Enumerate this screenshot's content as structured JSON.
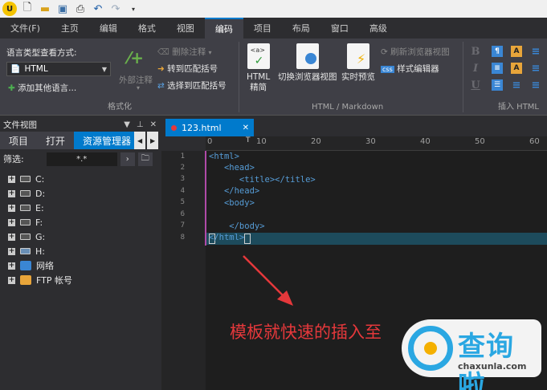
{
  "menu_tabs": [
    "文件(F)",
    "主页",
    "编辑",
    "格式",
    "视图",
    "编码",
    "项目",
    "布局",
    "窗口",
    "高级"
  ],
  "active_menu_tab": "编码",
  "ribbon": {
    "lang_view_label": "语言类型查看方式:",
    "lang_value": "HTML",
    "add_lang_label": "添加其他语言...",
    "outer_comment": "外部注释",
    "delete_comment": "删除注释",
    "goto_bracket": "转到匹配括号",
    "select_bracket": "选择到匹配括号",
    "format_group": "格式化",
    "html_tidy": [
      "HTML",
      "精简"
    ],
    "switch_browser_view": "切换浏览器视图",
    "live_preview": "实时预览",
    "refresh_browser_view": "刷新浏览器视图",
    "style_editor": "样式编辑器",
    "html_md_group": "HTML / Markdown",
    "insert_html_group": "插入 HTML"
  },
  "left_panel": {
    "title": "文件视图",
    "tabs": [
      "项目",
      "打开",
      "资源管理器"
    ],
    "active_tab": "资源管理器",
    "filter_label": "筛选:",
    "filter_value": "*.*",
    "drives": [
      "C:",
      "D:",
      "E:",
      "F:",
      "G:",
      "H:"
    ],
    "network": "网络",
    "ftp": "FTP 帐号"
  },
  "editor": {
    "tab_name": "123.html",
    "ruler_numbers": [
      "0",
      "10",
      "20",
      "30",
      "40",
      "50",
      "60"
    ],
    "line_numbers": [
      "1",
      "2",
      "3",
      "4",
      "5",
      "6",
      "7",
      "8"
    ],
    "code_lines": [
      "<html>",
      "   <head>",
      "      <title></title>",
      "   </head>",
      "   <body>",
      "",
      "    </body>",
      "</html>"
    ]
  },
  "annotation": "模板就快速的插入至",
  "watermark": {
    "brand": "查询啦",
    "domain": "chaxunla.com"
  },
  "colors": {
    "accent": "#007acc",
    "annotation": "#e5383b",
    "brand": "#2aa7e2"
  }
}
